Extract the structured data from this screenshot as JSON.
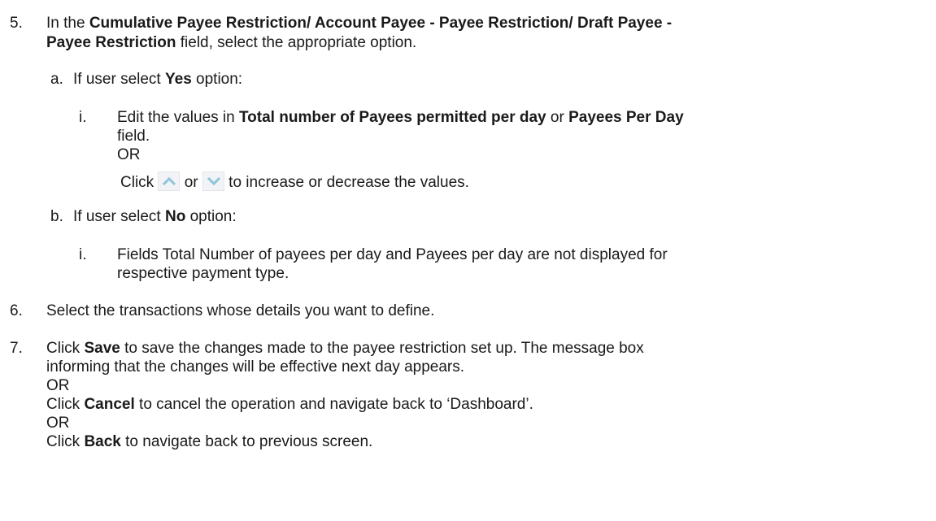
{
  "step5": {
    "number": "5.",
    "pre": "In the ",
    "field_bold_1": "Cumulative Payee Restriction/ Account Payee - Payee Restriction/ Draft Payee -",
    "field_bold_2": "Payee Restriction",
    "post": " field, select the appropriate option.",
    "a": {
      "marker": "a.",
      "pre": "If user select ",
      "bold": "Yes",
      "post": " option:",
      "i": {
        "marker": "i.",
        "pre": "Edit the values in ",
        "bold1": "Total number of Payees permitted per day",
        "mid": " or ",
        "bold2": "Payees Per Day",
        "line2": "field.",
        "or": "OR",
        "click": "Click ",
        "or_between": " or ",
        "post": " to increase or decrease the values.",
        "up_icon": "chevron-up-icon",
        "down_icon": "chevron-down-icon"
      }
    },
    "b": {
      "marker": "b.",
      "pre": "If user select ",
      "bold": "No",
      "post": " option:",
      "i": {
        "marker": "i.",
        "line1": "Fields Total Number of payees per day and Payees per day are not displayed for",
        "line2": "respective payment type."
      }
    }
  },
  "step6": {
    "number": "6.",
    "text": "Select the transactions whose details you want to define."
  },
  "step7": {
    "number": "7.",
    "click1": "Click ",
    "save": "Save",
    "line1_post": " to save the changes made to the payee restriction set up. The message box",
    "line2": "informing that the changes will be effective next day appears.",
    "or1": "OR",
    "click2": "Click ",
    "cancel": "Cancel",
    "cancel_post": " to cancel the operation and navigate back to ‘Dashboard’.",
    "or2": "OR",
    "click3": "Click ",
    "back": "Back",
    "back_post": " to navigate back to previous screen."
  },
  "colors": {
    "text": "#1a1a1a",
    "icon_bg": "#f1f3f6",
    "icon_chevron": "#8fc4da"
  }
}
